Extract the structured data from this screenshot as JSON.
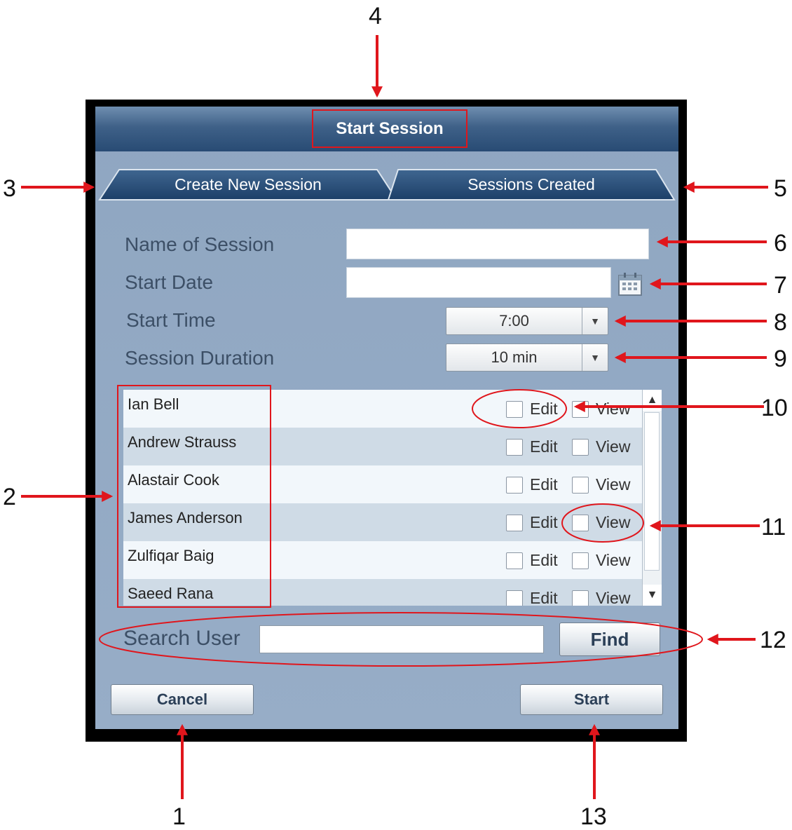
{
  "callouts": [
    "1",
    "2",
    "3",
    "4",
    "5",
    "6",
    "7",
    "8",
    "9",
    "10",
    "11",
    "12",
    "13"
  ],
  "dialog": {
    "title": "Start Session",
    "tabs": [
      {
        "label": "Create New Session",
        "active": true
      },
      {
        "label": "Sessions Created",
        "active": false
      }
    ],
    "form": {
      "name_label": "Name of Session",
      "name_value": "",
      "start_date_label": "Start Date",
      "start_date_value": "",
      "start_time_label": "Start Time",
      "start_time_value": "7:00",
      "duration_label": "Session Duration",
      "duration_value": "10 min"
    },
    "users": [
      {
        "name": "Ian Bell",
        "edit": false,
        "view": false
      },
      {
        "name": "Andrew Strauss",
        "edit": false,
        "view": false
      },
      {
        "name": "Alastair Cook",
        "edit": false,
        "view": false
      },
      {
        "name": "James Anderson",
        "edit": false,
        "view": false
      },
      {
        "name": "Zulfiqar Baig",
        "edit": false,
        "view": false
      },
      {
        "name": "Saeed Rana",
        "edit": false,
        "view": false
      }
    ],
    "edit_label": "Edit",
    "view_label": "View",
    "search": {
      "label": "Search User",
      "value": "",
      "find_label": "Find"
    },
    "cancel_label": "Cancel",
    "start_label": "Start"
  },
  "colors": {
    "annotation_red": "#e0161c",
    "dialog_bg": "#93a9c3",
    "title_bar": "#2d5079"
  }
}
